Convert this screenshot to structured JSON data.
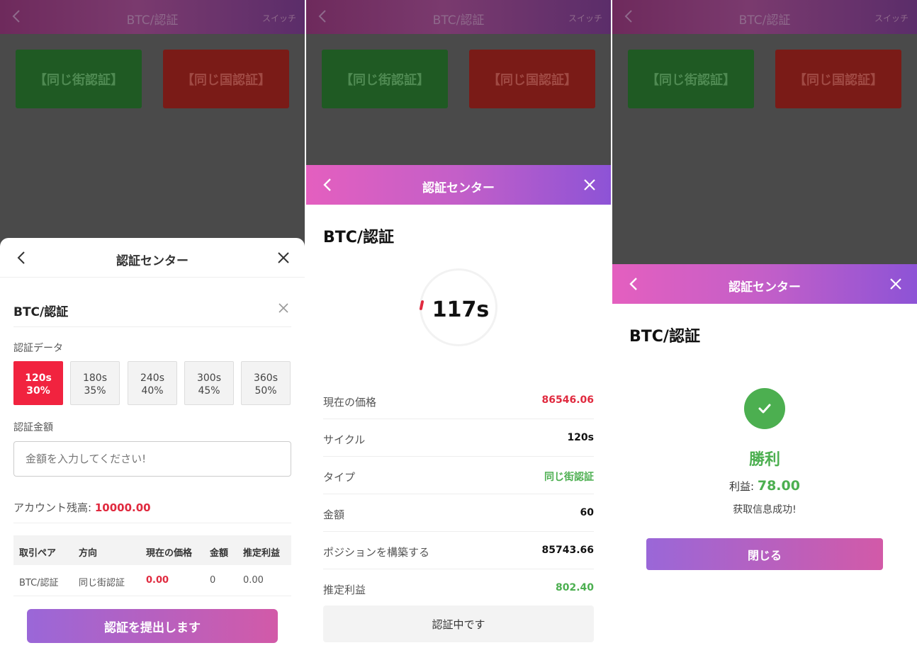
{
  "colors": {
    "accent_red": "#f1233f",
    "green": "#4caf50",
    "gradient_start": "#e45fbf",
    "gradient_end": "#8d53d6"
  },
  "topbar": {
    "title": "BTC/認証",
    "switch_label": "スイッチ"
  },
  "choices": {
    "street": "【同じ街認証】",
    "country": "【同じ国認証】"
  },
  "sheet": {
    "title": "認証センター"
  },
  "panel1": {
    "pair": "BTC/認証",
    "data_label": "認証データ",
    "options": [
      {
        "time": "120s",
        "rate": "30%"
      },
      {
        "time": "180s",
        "rate": "35%"
      },
      {
        "time": "240s",
        "rate": "40%"
      },
      {
        "time": "300s",
        "rate": "45%"
      },
      {
        "time": "360s",
        "rate": "50%"
      }
    ],
    "amount_label": "認証金額",
    "amount_placeholder": "金額を入力してください!",
    "balance_label": "アカウント残高: ",
    "balance_value": "10000.00",
    "table_headers": [
      "取引ペア",
      "方向",
      "現在の価格",
      "金額",
      "推定利益"
    ],
    "table_row": [
      "BTC/認証",
      "同じ街認証",
      "0.00",
      "0",
      "0.00"
    ],
    "submit_label": "認証を提出します"
  },
  "panel2": {
    "pair": "BTC/認証",
    "countdown": "117s",
    "rows": [
      {
        "k": "現在の価格",
        "v": "86546.06"
      },
      {
        "k": "サイクル",
        "v": "120s"
      },
      {
        "k": "タイプ",
        "v": "同じ街認証"
      },
      {
        "k": "金額",
        "v": "60"
      },
      {
        "k": "ポジションを構築する",
        "v": "85743.66"
      },
      {
        "k": "推定利益",
        "v": "802.40"
      }
    ],
    "status": "認証中です"
  },
  "panel3": {
    "pair": "BTC/認証",
    "result": "勝利",
    "profit_label": "利益: ",
    "profit_value": "78.00",
    "message": "获取信息成功!",
    "close_label": "閉じる"
  }
}
